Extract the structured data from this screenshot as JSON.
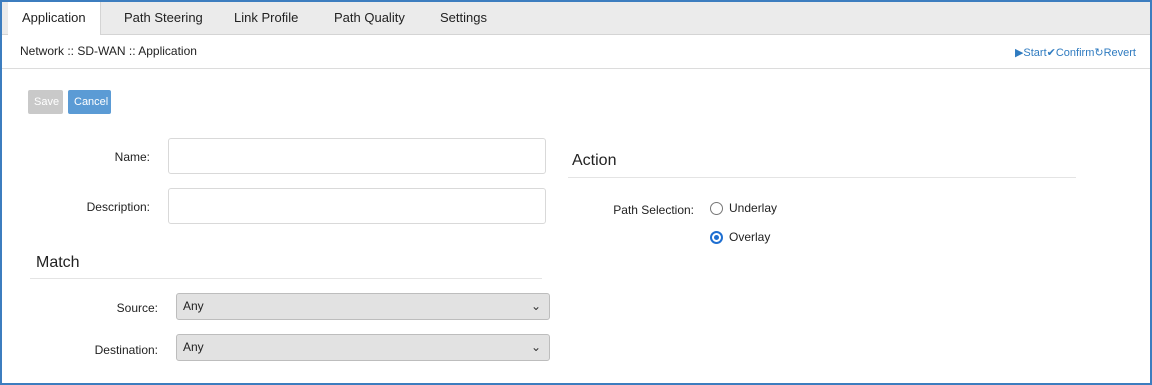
{
  "tabs": [
    {
      "label": "Application",
      "active": true
    },
    {
      "label": "Path Steering",
      "active": false
    },
    {
      "label": "Link Profile",
      "active": false
    },
    {
      "label": "Path Quality",
      "active": false
    },
    {
      "label": "Settings",
      "active": false
    }
  ],
  "breadcrumb": "Network :: SD-WAN :: Application",
  "header_actions": {
    "start": "▶Start",
    "confirm": "✔Confirm",
    "revert": "↻Revert",
    "color": "#2f7bc0"
  },
  "toolbar": {
    "save_label": "Save",
    "cancel_label": "Cancel"
  },
  "form": {
    "name_label": "Name:",
    "name_value": "",
    "description_label": "Description:",
    "description_value": ""
  },
  "match": {
    "title": "Match",
    "source_label": "Source:",
    "source_value": "Any",
    "destination_label": "Destination:",
    "destination_value": "Any"
  },
  "action": {
    "title": "Action",
    "path_selection_label": "Path Selection:",
    "options": [
      {
        "label": "Underlay",
        "checked": false
      },
      {
        "label": "Overlay",
        "checked": true
      }
    ]
  },
  "icons": {
    "dropdown": "chevron-down-icon"
  },
  "colors": {
    "accent": "#5b9bd5",
    "radio": "#1f6fd1",
    "border": "#3c7dbf"
  }
}
